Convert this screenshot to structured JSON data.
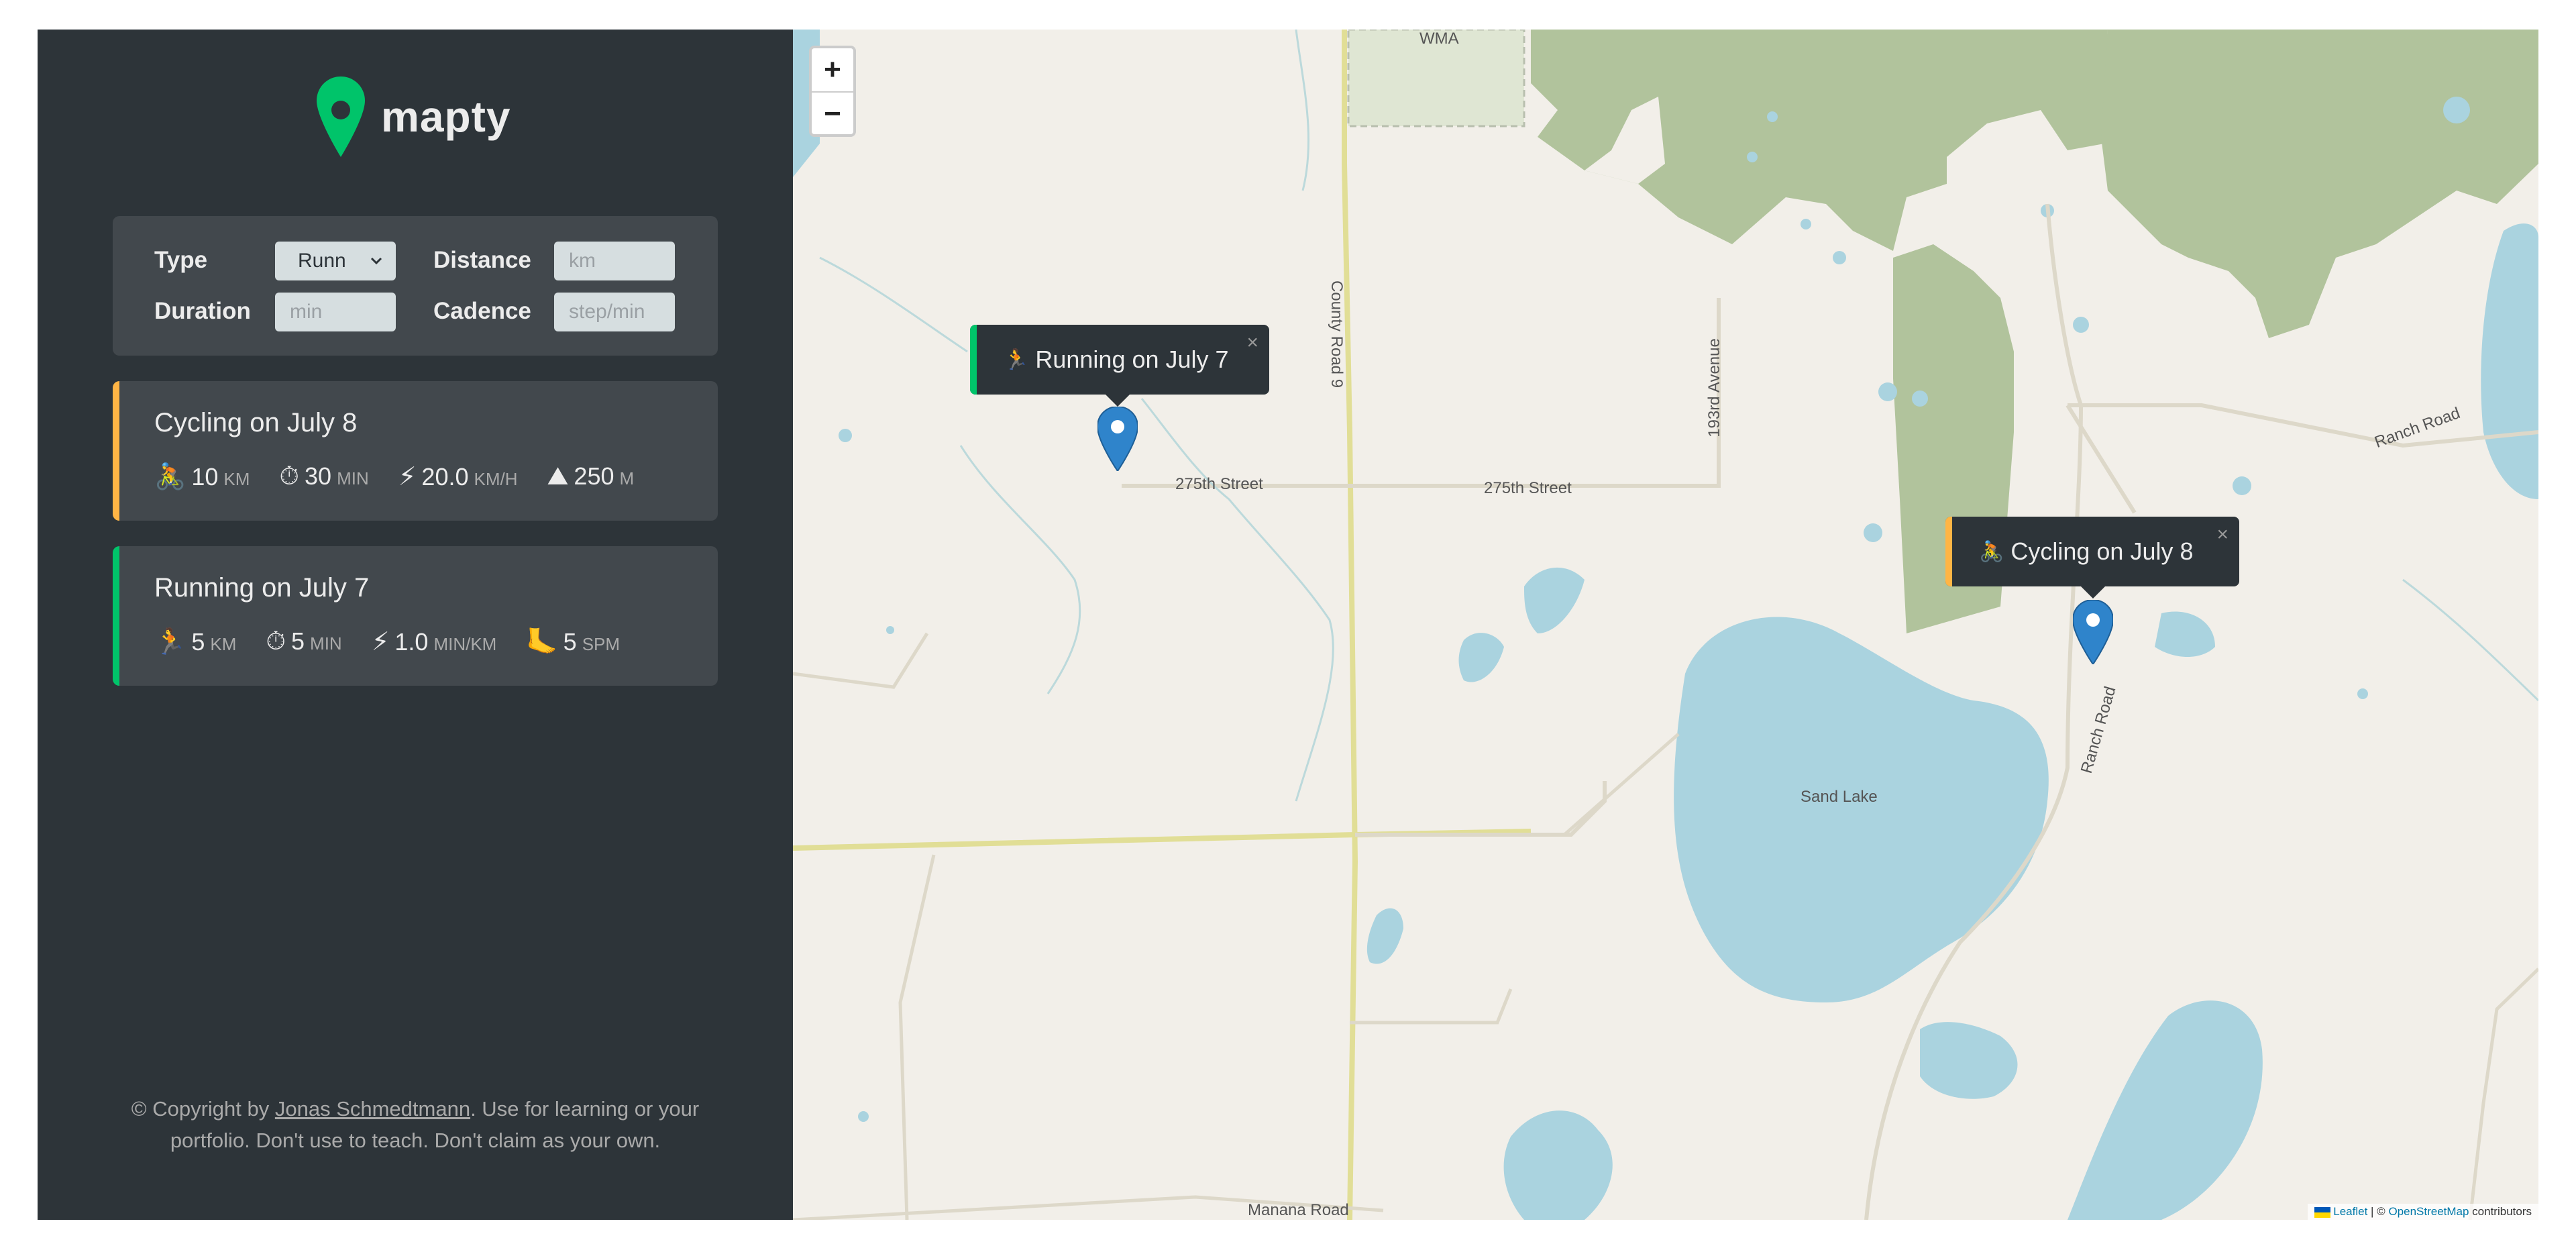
{
  "logo": {
    "text": "mapty"
  },
  "form": {
    "type_label": "Type",
    "type_value": "Runn",
    "distance_label": "Distance",
    "distance_placeholder": "km",
    "duration_label": "Duration",
    "duration_placeholder": "min",
    "cadence_label": "Cadence",
    "cadence_placeholder": "step/min"
  },
  "workouts": [
    {
      "title": "Cycling on July 8",
      "accent": "#ffb545",
      "details": [
        {
          "icon": "🚴",
          "value": "10",
          "unit": "km"
        },
        {
          "icon": "⏱",
          "value": "30",
          "unit": "min"
        },
        {
          "icon": "⚡",
          "value": "20.0",
          "unit": "km/h"
        },
        {
          "icon": "⛰",
          "value": "250",
          "unit": "m"
        }
      ]
    },
    {
      "title": "Running on July 7",
      "accent": "#00c46a",
      "details": [
        {
          "icon": "🏃",
          "value": "5",
          "unit": "km"
        },
        {
          "icon": "⏱",
          "value": "5",
          "unit": "min"
        },
        {
          "icon": "⚡",
          "value": "1.0",
          "unit": "min/km"
        },
        {
          "icon": "🦶",
          "value": "5",
          "unit": "spm"
        }
      ]
    }
  ],
  "copyright": {
    "prefix": "© Copyright by ",
    "author": "Jonas Schmedtmann",
    "suffix": ". Use for learning or your portfolio. Don't use to teach. Don't claim as your own."
  },
  "map": {
    "zoom_in": "+",
    "zoom_out": "−",
    "labels": {
      "wma": "WMA",
      "street1": "275th Street",
      "street2": "275th Street",
      "county_road": "County Road 9",
      "avenue": "193rd Avenue",
      "ranch_road1": "Ranch Road",
      "ranch_road2": "Ranch Road",
      "sand_lake": "Sand Lake",
      "manana_road": "Manana Road"
    },
    "popups": [
      {
        "icon": "🏃",
        "text": "Running on July 7",
        "close": "×",
        "accent": "#00c46a"
      },
      {
        "icon": "🚴",
        "text": "Cycling on July 8",
        "close": "×",
        "accent": "#ffb545"
      }
    ],
    "attribution": {
      "leaflet": "Leaflet",
      "separator": " | © ",
      "osm": "OpenStreetMap",
      "suffix": " contributors"
    }
  }
}
